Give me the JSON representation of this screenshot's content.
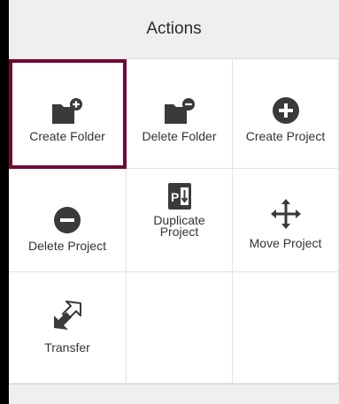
{
  "header": {
    "title": "Actions"
  },
  "actions": [
    {
      "label": "Create Folder",
      "icon": "folder-plus-icon"
    },
    {
      "label": "Delete Folder",
      "icon": "folder-minus-icon"
    },
    {
      "label": "Create Project",
      "icon": "plus-circle-icon"
    },
    {
      "label": "Delete Project",
      "icon": "minus-circle-icon"
    },
    {
      "label": "Duplicate\nProject",
      "icon": "duplicate-project-icon"
    },
    {
      "label": "Move Project",
      "icon": "move-arrows-icon"
    },
    {
      "label": "Transfer",
      "icon": "transfer-arrows-icon"
    }
  ],
  "selected_action": "Create Folder",
  "colors": {
    "accent": "#6e0a36",
    "icon": "#3a3a3a",
    "header_bg": "#efefef"
  }
}
